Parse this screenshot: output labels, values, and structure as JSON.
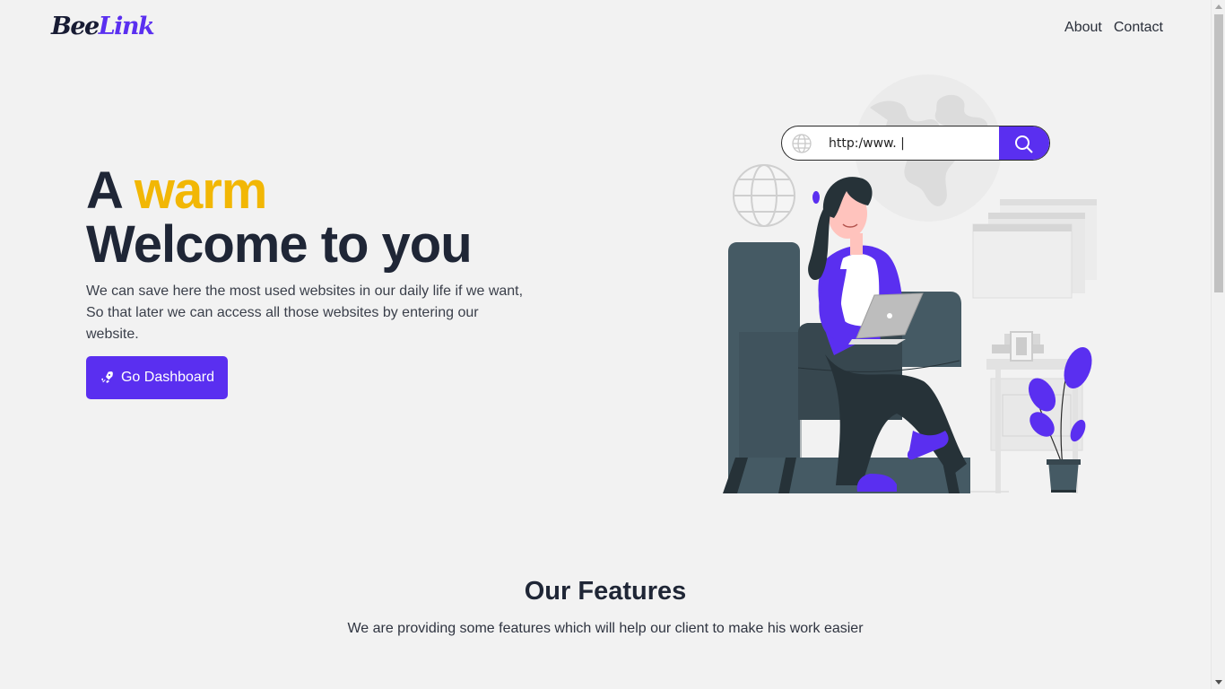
{
  "brand": {
    "part1": "Bee",
    "part2": "Link"
  },
  "nav": {
    "about": "About",
    "contact": "Contact"
  },
  "hero": {
    "title_a": "A",
    "title_accent": "warm",
    "title_line2": "Welcome to you",
    "description": "We can save here the most used websites in our daily life if we want, So that later we can access all those websites by entering our website.",
    "cta_label": "Go Dashboard",
    "cta_icon": "rocket-icon"
  },
  "illustration": {
    "search_value": "http:/www. |",
    "search_icon": "search-icon",
    "globe_icon": "globe-icon"
  },
  "features": {
    "title": "Our Features",
    "subtitle": "We are providing some features which will help our client to make his work easier"
  },
  "colors": {
    "accent": "#5a2ff0",
    "highlight": "#f2b705",
    "text_dark": "#1f2636",
    "background": "#f2f2f2"
  }
}
